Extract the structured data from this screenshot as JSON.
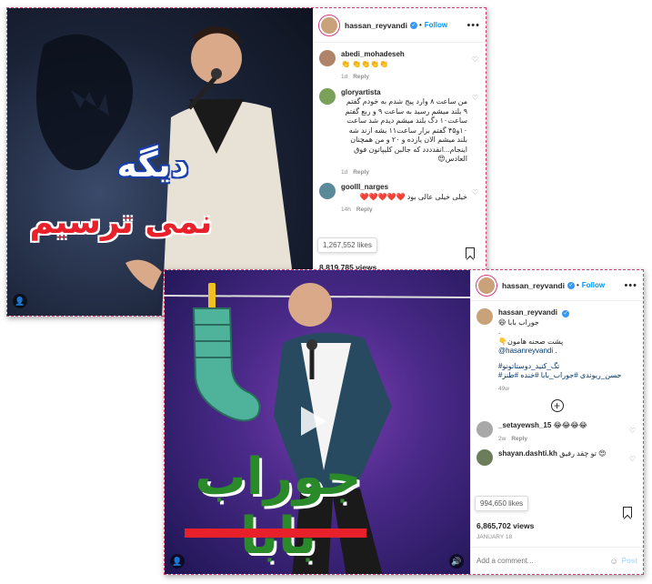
{
  "post1": {
    "overlay_top": "دیگه",
    "overlay_bottom": "نمی ترسیم",
    "username": "hassan_reyvandi",
    "follow": "Follow",
    "comments": [
      {
        "user": "abedi_mohadeseh",
        "text": "👏👏👏👏 👏",
        "time": "1d",
        "reply": "Reply"
      },
      {
        "user": "gloryartista",
        "text": "من ساعت ۸ وارد پیج شدم به خودم گفتم ۹ بلند میشم رسید به ساعت ۹ و ربع گفتم ساعت۱۰ دگ بلند میشم دیدم شد ساعت ۱۰و۴۵ گفتم بزار ساعت۱۱ بشه ازند شه بلند میشم الان یازده و ۲۰ و من همچنان اینجام...انقدددد که جالبن کلیپاتون فوق العادس😍",
        "time": "1d",
        "reply": "Reply"
      },
      {
        "user": "goolll_narges",
        "text": "خیلی خیلی عالی بود ❤️❤️❤️❤️❤️",
        "time": "14h",
        "reply": "Reply"
      }
    ],
    "likes": "1,267,552 likes",
    "views": "8,819,785 views"
  },
  "post2": {
    "overlay_title": "جوراب بابا",
    "username": "hassan_reyvandi",
    "follow": "Follow",
    "caption_user": "hassan_reyvandi",
    "caption_lines": [
      "جوراب بابا 😆",
      ".",
      "پشت صحنه هامون👇",
      "@hasanreyvandi ."
    ],
    "hashtags_1": "تگ_کنید_دوستاتونو#",
    "hashtags_2": "حسن_ریوندی #جوراب_بابا #خنده #طنز#",
    "caption_time": "49w",
    "comments": [
      {
        "user": "_setayewsh_15",
        "text": "😂😂😂😂",
        "time": "2w",
        "reply": "Reply"
      },
      {
        "user": "shayan.dashti.kh",
        "text": "تو چقد رفیق 😍",
        "time": "",
        "reply": ""
      }
    ],
    "likes": "994,650 likes",
    "views": "6,865,702 views",
    "date": "JANUARY 18",
    "add_comment_placeholder": "Add a comment...",
    "post_button": "Post"
  }
}
